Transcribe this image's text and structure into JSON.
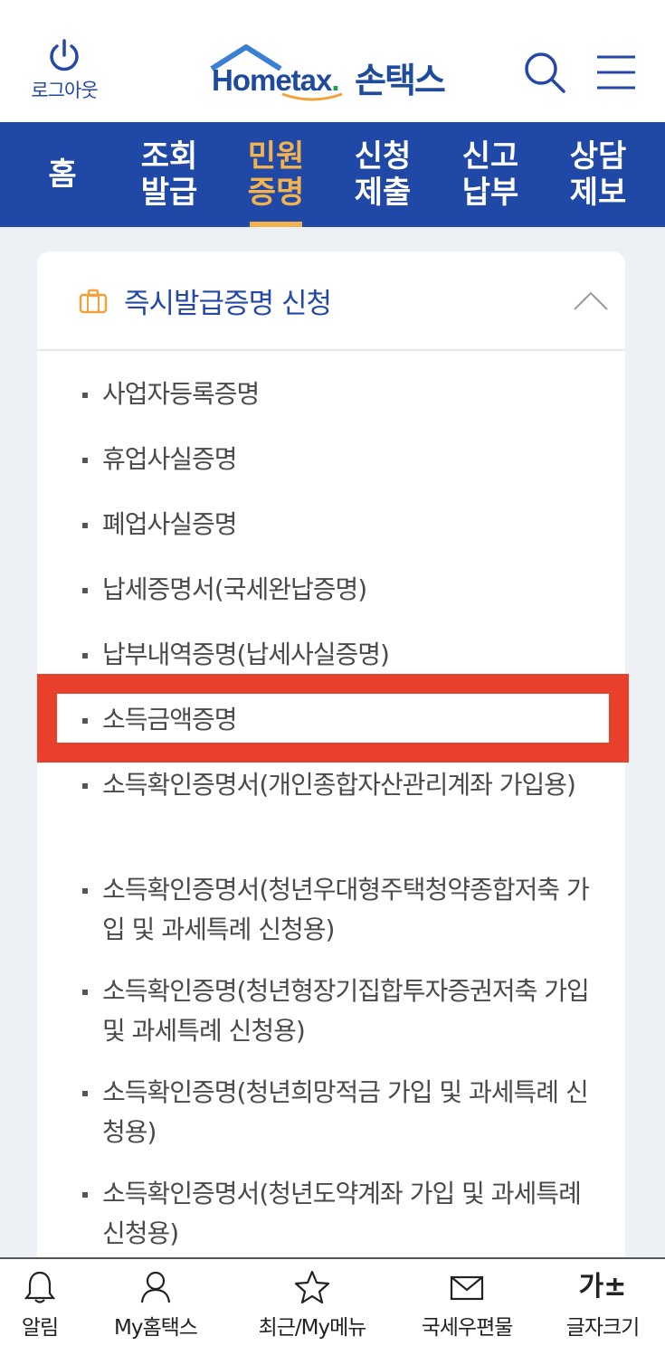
{
  "header": {
    "logout_label": "로그아웃",
    "logo_text": "Hometax",
    "logo_dot": ".",
    "logo_korean": "손택스"
  },
  "nav": {
    "items": [
      {
        "label": "홈"
      },
      {
        "label": "조회\n발급"
      },
      {
        "label": "민원\n증명"
      },
      {
        "label": "신청\n제출"
      },
      {
        "label": "신고\n납부"
      },
      {
        "label": "상담\n제보"
      }
    ],
    "active_index": 2
  },
  "section": {
    "title": "즉시발급증명 신청",
    "items": [
      {
        "label": "사업자등록증명"
      },
      {
        "label": "휴업사실증명"
      },
      {
        "label": "폐업사실증명"
      },
      {
        "label": "납세증명서(국세완납증명)"
      },
      {
        "label": "납부내역증명(납세사실증명)"
      },
      {
        "label": "소득금액증명"
      },
      {
        "label": "소득확인증명서(개인종합자산관리계좌 가입용)"
      },
      {
        "label": "소득확인증명서(청년우대형주택청약종합저축 가입 및 과세특례 신청용)"
      },
      {
        "label": "소득확인증명(청년형장기집합투자증권저축 가입 및 과세특례 신청용)"
      },
      {
        "label": "소득확인증명(청년희망적금 가입 및 과세특례 신청용)"
      },
      {
        "label": "소득확인증명서(청년도약계좌 가입 및 과세특례 신청용)"
      }
    ],
    "highlighted_index": 5
  },
  "bottom_bar": {
    "items": [
      {
        "label": "알림",
        "icon": "bell-icon"
      },
      {
        "label": "My홈택스",
        "icon": "person-icon"
      },
      {
        "label": "최근/My메뉴",
        "icon": "star-icon"
      },
      {
        "label": "국세우편물",
        "icon": "mail-icon"
      },
      {
        "label": "글자크기",
        "icon": "font-size-icon",
        "glyph": "가±"
      }
    ]
  },
  "colors": {
    "brand_blue": "#2049a7",
    "active_nav": "#f2b24e",
    "highlight_red": "#e8402a"
  }
}
